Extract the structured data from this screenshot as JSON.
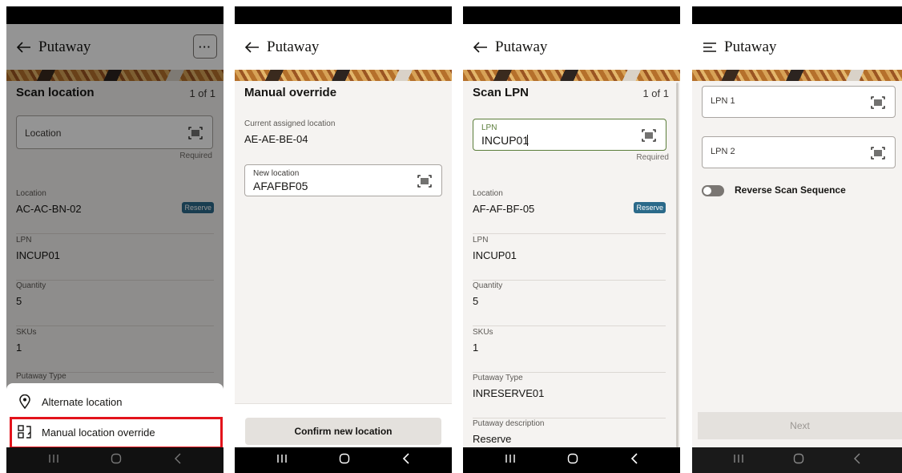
{
  "screens": [
    {
      "title": "Putaway",
      "more_label": "···",
      "section": "Scan location",
      "count": "1 of 1",
      "field": {
        "label": "Location",
        "required": "Required"
      },
      "info": [
        {
          "label": "Location",
          "value": "AC-AC-BN-02",
          "badge": "Reserve"
        },
        {
          "label": "LPN",
          "value": "INCUP01"
        },
        {
          "label": "Quantity",
          "value": "5"
        },
        {
          "label": "SKUs",
          "value": "1"
        },
        {
          "label": "Putaway Type",
          "value": ""
        }
      ],
      "sheet": [
        {
          "label": "Alternate location",
          "icon": "location-pin-icon"
        },
        {
          "label": "Manual location override",
          "icon": "location-override-icon"
        }
      ]
    },
    {
      "title": "Putaway",
      "section": "Manual override",
      "current_label": "Current assigned location",
      "current_value": "AE-AE-BE-04",
      "field": {
        "label": "New location",
        "value": "AFAFBF05"
      },
      "button": "Confirm new location"
    },
    {
      "title": "Putaway",
      "section": "Scan LPN",
      "count": "1 of 1",
      "field": {
        "label": "LPN",
        "value": "INCUP01",
        "required": "Required"
      },
      "info": [
        {
          "label": "Location",
          "value": "AF-AF-BF-05",
          "badge": "Reserve"
        },
        {
          "label": "LPN",
          "value": "INCUP01"
        },
        {
          "label": "Quantity",
          "value": "5"
        },
        {
          "label": "SKUs",
          "value": "1"
        },
        {
          "label": "Putaway Type",
          "value": "INRESERVE01"
        },
        {
          "label": "Putaway description",
          "value": "Reserve"
        }
      ]
    },
    {
      "title": "Putaway",
      "fields": [
        {
          "label": "LPN 1"
        },
        {
          "label": "LPN 2"
        }
      ],
      "toggle_label": "Reverse Scan Sequence",
      "button": "Next"
    }
  ],
  "colors": {
    "highlight": "#e3131b",
    "badge": "#2b6a8a",
    "field_active_border": "#5b7d3a"
  }
}
